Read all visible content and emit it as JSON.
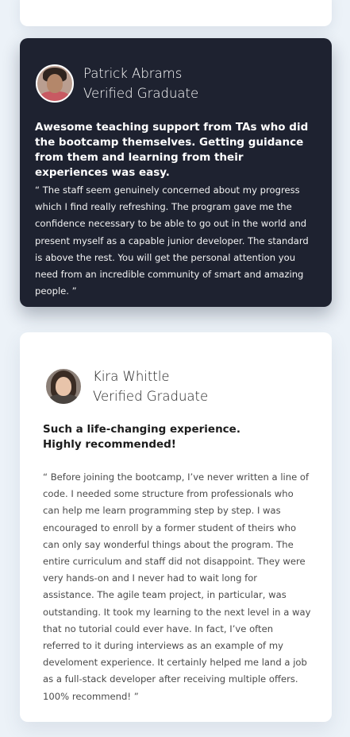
{
  "testimonials": [
    {
      "name": "Patrick Abrams",
      "status": "Verified Graduate",
      "headline": "Awesome teaching support from TAs who did the bootcamp themselves. Getting guidance from them and learning from their experiences was easy.",
      "quote": "“ The staff seem genuinely concerned about my progress which I find really refreshing. The program gave me the confidence necessary to be able to go out in the world and present myself as a capable junior developer. The standard is above the rest. You will get the personal attention you need from an incredible community of smart and amazing people. ”",
      "theme_color": "#1e2230"
    },
    {
      "name": "Kira Whittle",
      "status": "Verified Graduate",
      "headline": "Such a life-changing experience. Highly recommended!",
      "quote": "“ Before joining the bootcamp, I’ve never written a line of code. I needed some structure from professionals who can help me learn programming step by step. I was encouraged to enroll by a former student of theirs who can only say wonderful things about the program. The entire curriculum and staff did not disappoint. They were very hands-on and I never had to wait long for assistance. The agile team project, in particular, was outstanding. It took my learning to the next level in a way that no tutorial could ever have. In fact, I’ve often referred to it during interviews as an example of my develoment experience. It certainly helped me land a job as a full-stack developer after receiving multiple offers. 100% recommend! ”",
      "theme_color": "#ffffff"
    }
  ]
}
